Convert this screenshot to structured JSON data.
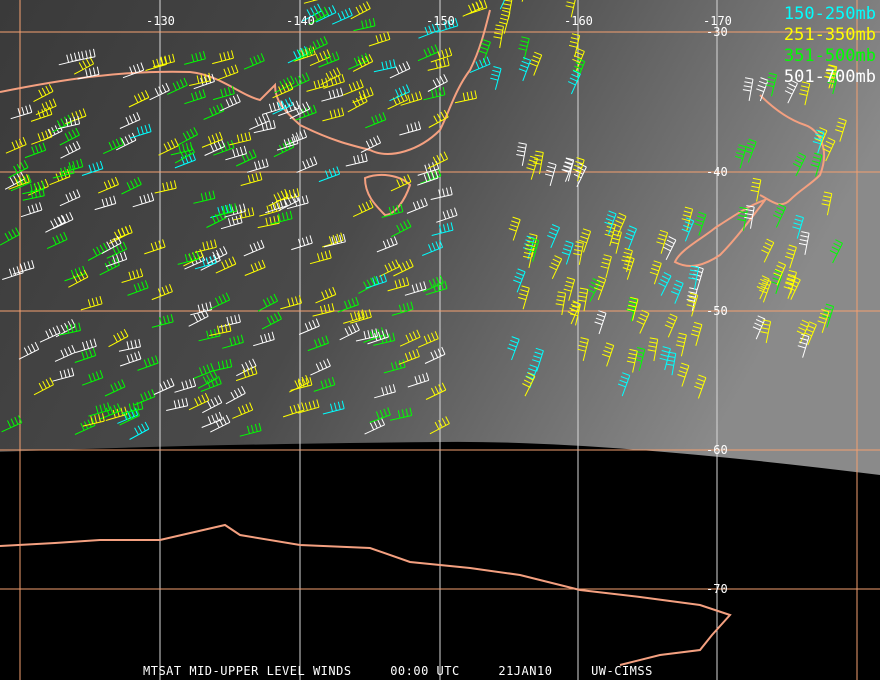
{
  "legend": [
    {
      "label": "150-250mb",
      "color": "#00ffff"
    },
    {
      "label": "251-350mb",
      "color": "#ffff00"
    },
    {
      "label": "351-500mb",
      "color": "#00ff00"
    },
    {
      "label": "501-700mb",
      "color": "#ffffff"
    }
  ],
  "longitude_labels": [
    "-130",
    "-140",
    "-150",
    "-160",
    "-170"
  ],
  "latitude_labels": [
    "-30",
    "-40",
    "-50",
    "-60",
    "-70"
  ],
  "caption": {
    "product": "MTSAT MID-UPPER LEVEL WINDS",
    "time": "00:00 UTC",
    "date": "21JAN10",
    "source": "UW-CIMSS"
  },
  "colors": {
    "grid": "#f4a070",
    "coast": "#f4a080"
  }
}
